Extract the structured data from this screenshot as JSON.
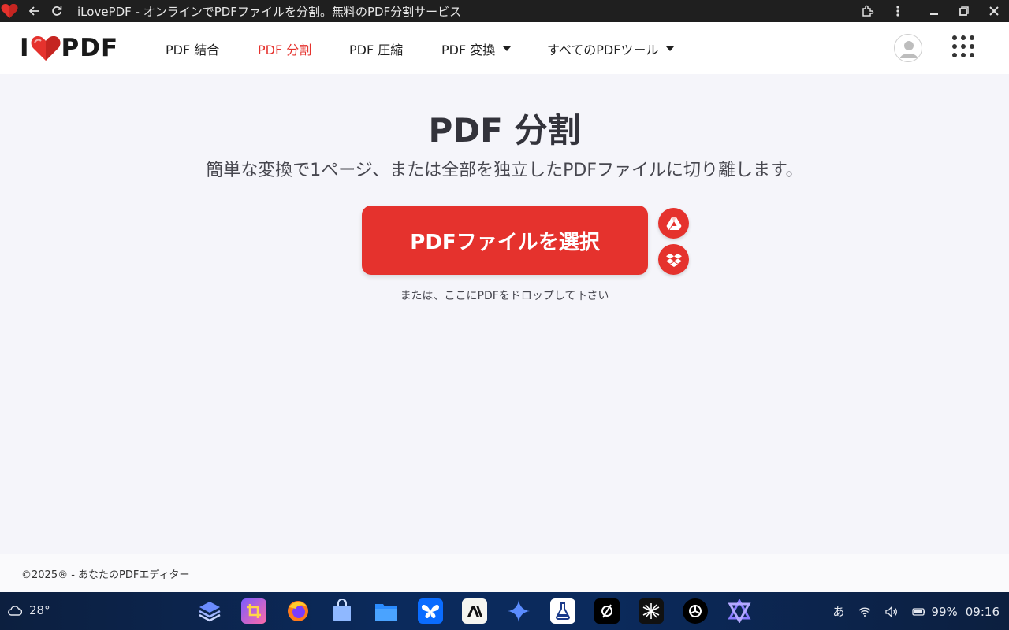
{
  "window": {
    "title": "iLovePDF - オンラインでPDFファイルを分割。無料のPDF分割サービス"
  },
  "header": {
    "logo_left": "I",
    "logo_right": "PDF",
    "nav": [
      {
        "label": "PDF 結合",
        "active": false
      },
      {
        "label": "PDF 分割",
        "active": true
      },
      {
        "label": "PDF 圧縮",
        "active": false
      },
      {
        "label": "PDF 変換",
        "active": false,
        "dropdown": true
      },
      {
        "label": "すべてのPDFツール",
        "active": false,
        "dropdown": true
      }
    ]
  },
  "main": {
    "title": "PDF 分割",
    "subtitle": "簡単な変換で1ページ、または全部を独立したPDFファイルに切り離します。",
    "select_button": "PDFファイルを選択",
    "drop_hint": "または、ここにPDFをドロップして下さい",
    "cloud_sources": [
      "google-drive-icon",
      "dropbox-icon"
    ]
  },
  "footer": {
    "text": "©2025® - あなたのPDFエディター"
  },
  "taskbar": {
    "temperature": "28°",
    "ime": "あ",
    "battery": "99%",
    "time": "09:16"
  },
  "colors": {
    "accent": "#e5322d",
    "background": "#f5f5fa",
    "titlebar": "#1f1f1f",
    "taskbar": "#0b2a5c"
  }
}
